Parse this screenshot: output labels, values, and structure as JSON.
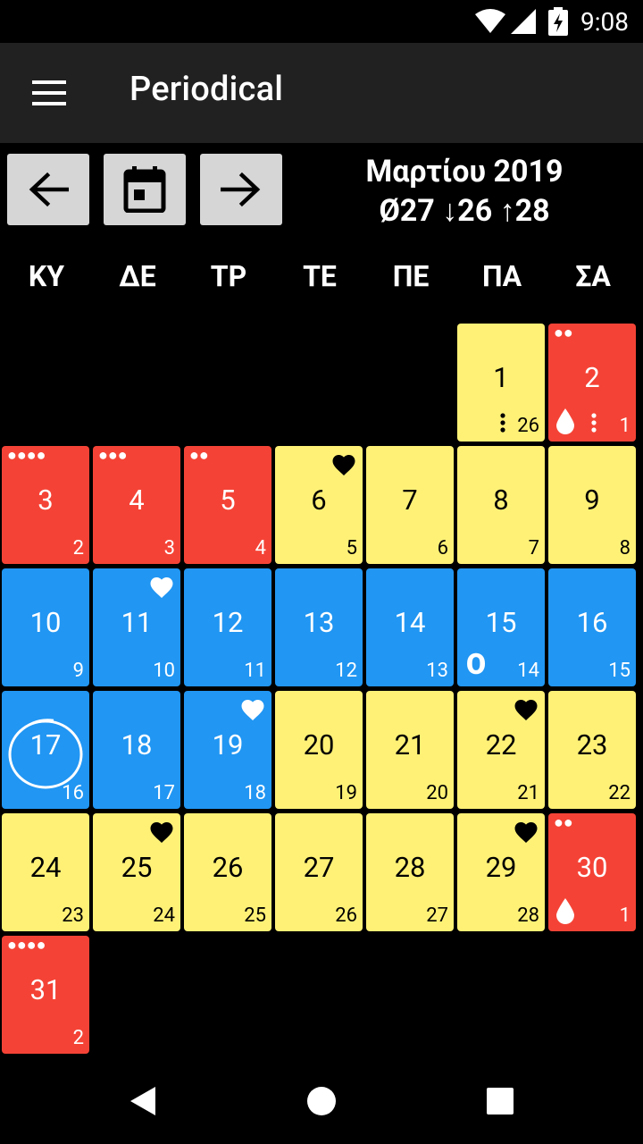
{
  "status_bar": {
    "time": "9:08"
  },
  "app_title": "Periodical",
  "header": {
    "month": "Μαρτίου 2019",
    "stats": "Ø27 ↓26 ↑28"
  },
  "weekdays": [
    "ΚΥ",
    "ΔΕ",
    "ΤΡ",
    "ΤΕ",
    "ΠΕ",
    "ΠΑ",
    "ΣΑ"
  ],
  "days": [
    {
      "day": "1",
      "cycle": "26"
    },
    {
      "day": "2",
      "cycle": "1"
    },
    {
      "day": "3",
      "cycle": "2"
    },
    {
      "day": "4",
      "cycle": "3"
    },
    {
      "day": "5",
      "cycle": "4"
    },
    {
      "day": "6",
      "cycle": "5"
    },
    {
      "day": "7",
      "cycle": "6"
    },
    {
      "day": "8",
      "cycle": "7"
    },
    {
      "day": "9",
      "cycle": "8"
    },
    {
      "day": "10",
      "cycle": "9"
    },
    {
      "day": "11",
      "cycle": "10"
    },
    {
      "day": "12",
      "cycle": "11"
    },
    {
      "day": "13",
      "cycle": "12"
    },
    {
      "day": "14",
      "cycle": "13"
    },
    {
      "day": "15",
      "cycle": "14"
    },
    {
      "day": "16",
      "cycle": "15"
    },
    {
      "day": "17",
      "cycle": "16"
    },
    {
      "day": "18",
      "cycle": "17"
    },
    {
      "day": "19",
      "cycle": "18"
    },
    {
      "day": "20",
      "cycle": "19"
    },
    {
      "day": "21",
      "cycle": "20"
    },
    {
      "day": "22",
      "cycle": "21"
    },
    {
      "day": "23",
      "cycle": "22"
    },
    {
      "day": "24",
      "cycle": "23"
    },
    {
      "day": "25",
      "cycle": "24"
    },
    {
      "day": "26",
      "cycle": "25"
    },
    {
      "day": "27",
      "cycle": "26"
    },
    {
      "day": "28",
      "cycle": "27"
    },
    {
      "day": "29",
      "cycle": "28"
    },
    {
      "day": "30",
      "cycle": "1"
    },
    {
      "day": "31",
      "cycle": "2"
    }
  ],
  "markers": {
    "ovulation": "O",
    "dots_2": "●●",
    "dots_3": "●●●",
    "dots_4": "●●●●"
  },
  "colors": {
    "period": "#f44336",
    "fertile": "#2196f3",
    "infertile": "#fff176",
    "toolbar": "#212121",
    "button": "#d6d6d6"
  },
  "icons": [
    "menu-icon",
    "arrow-left-icon",
    "calendar-today-icon",
    "arrow-right-icon",
    "heart-icon",
    "drop-icon",
    "ring-today-icon",
    "wifi-icon",
    "signal-icon",
    "battery-icon",
    "back-icon",
    "home-icon",
    "recents-icon"
  ]
}
